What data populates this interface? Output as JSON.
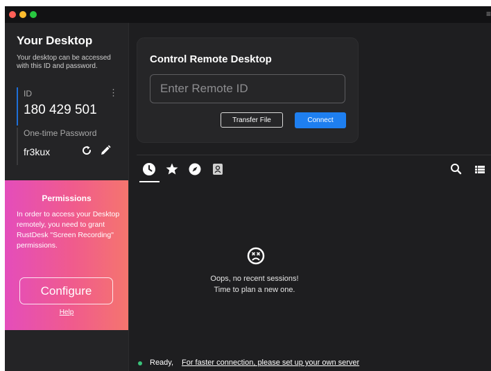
{
  "sidebar": {
    "title": "Your Desktop",
    "description": "Your desktop can be accessed with this ID and password.",
    "id_label": "ID",
    "id_value": "180 429 501",
    "password_label": "One-time Password",
    "password_value": "fr3kux"
  },
  "permissions": {
    "title": "Permissions",
    "text": "In order to access your Desktop remotely, you need to grant RustDesk \"Screen Recording\" permissions.",
    "configure_label": "Configure",
    "help_label": "Help"
  },
  "control": {
    "title": "Control Remote Desktop",
    "placeholder": "Enter Remote ID",
    "transfer_label": "Transfer File",
    "connect_label": "Connect"
  },
  "sessions": {
    "empty_line1": "Oops, no recent sessions!",
    "empty_line2": "Time to plan a new one."
  },
  "status": {
    "ready": "Ready,",
    "link": "For faster connection, please set up your own server"
  },
  "colors": {
    "accent": "#1e7ff0",
    "status_ok": "#3ac27a",
    "gradient_start": "#e44dbb",
    "gradient_end": "#f5756e"
  },
  "icons": {
    "tabs": [
      "clock-icon",
      "star-icon",
      "compass-icon",
      "address-book-icon"
    ],
    "right": [
      "search-icon",
      "view-list-icon"
    ]
  }
}
